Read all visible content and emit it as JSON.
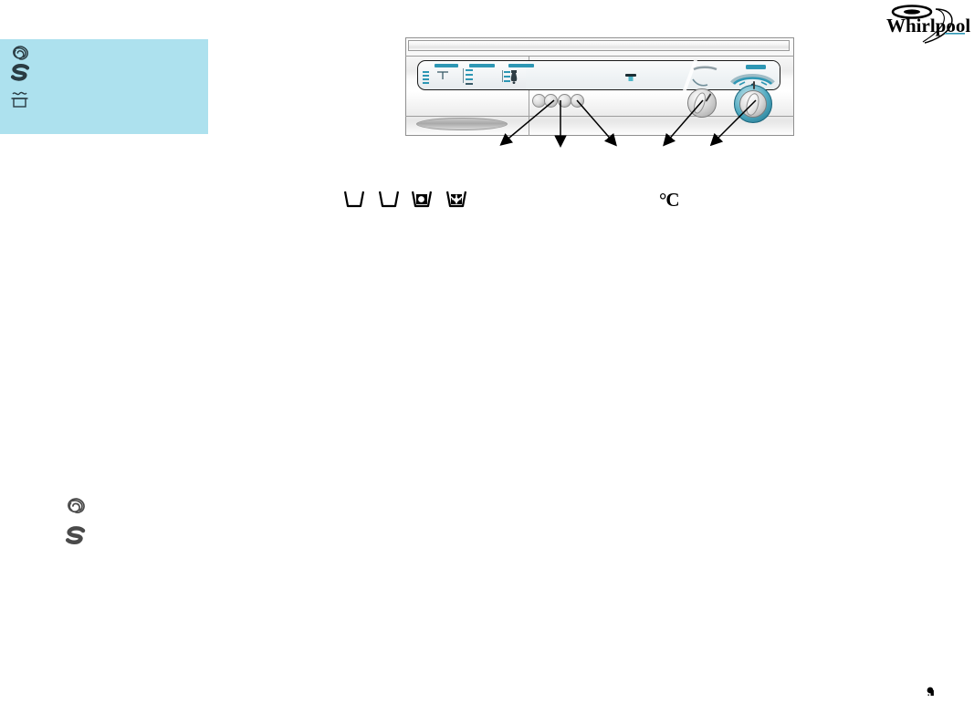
{
  "page": {
    "brand": "Whirlpool",
    "background_color": "#ffffff",
    "accent_teal": "#2e97b4",
    "legend_box_color": "#ade1ee"
  },
  "legend_box": {
    "items": [
      {
        "icon": "wool-swirl-icon",
        "label": ""
      },
      {
        "icon": "s-logo-icon",
        "label": ""
      },
      {
        "icon": "wash-tub-wave-icon",
        "label": ""
      }
    ]
  },
  "control_panel": {
    "title": "",
    "display_bezel": {
      "label": ""
    },
    "option_groups": [
      {
        "id": "option-group-1",
        "bar_label": ""
      },
      {
        "id": "option-group-2",
        "bar_label": ""
      },
      {
        "id": "option-group-3",
        "bar_label": ""
      },
      {
        "id": "option-group-4",
        "bar_label": ""
      }
    ],
    "buttons": [
      {
        "id": "panel-button-1",
        "label": ""
      },
      {
        "id": "panel-button-2",
        "label": ""
      },
      {
        "id": "panel-button-3",
        "label": ""
      },
      {
        "id": "panel-button-4",
        "label": ""
      }
    ],
    "knobs": [
      {
        "id": "temperature-knob",
        "label": ""
      },
      {
        "id": "programme-selector-knob",
        "label": ""
      }
    ],
    "drawer": {
      "id": "detergent-drawer",
      "label": ""
    },
    "centre_indicator": {
      "id": "spin-indicator",
      "label": ""
    }
  },
  "callouts": {
    "count": 5,
    "arrows": [
      {
        "id": "callout-1",
        "label": ""
      },
      {
        "id": "callout-2",
        "label": ""
      },
      {
        "id": "callout-3",
        "label": ""
      },
      {
        "id": "callout-4",
        "label": ""
      },
      {
        "id": "callout-5",
        "label": ""
      }
    ]
  },
  "care_symbols": [
    {
      "id": "wash-tub-symbol",
      "label": ""
    },
    {
      "id": "wash-tub-symbol-2",
      "label": ""
    },
    {
      "id": "tumble-dry-symbol",
      "label": ""
    },
    {
      "id": "tumble-dry-low-symbol",
      "label": ""
    }
  ],
  "degree_celsius": "°C",
  "icon_legend": [
    {
      "id": "wool-swirl-icon",
      "label": ""
    },
    {
      "id": "s-logo-icon",
      "label": ""
    }
  ],
  "page_mark": ""
}
